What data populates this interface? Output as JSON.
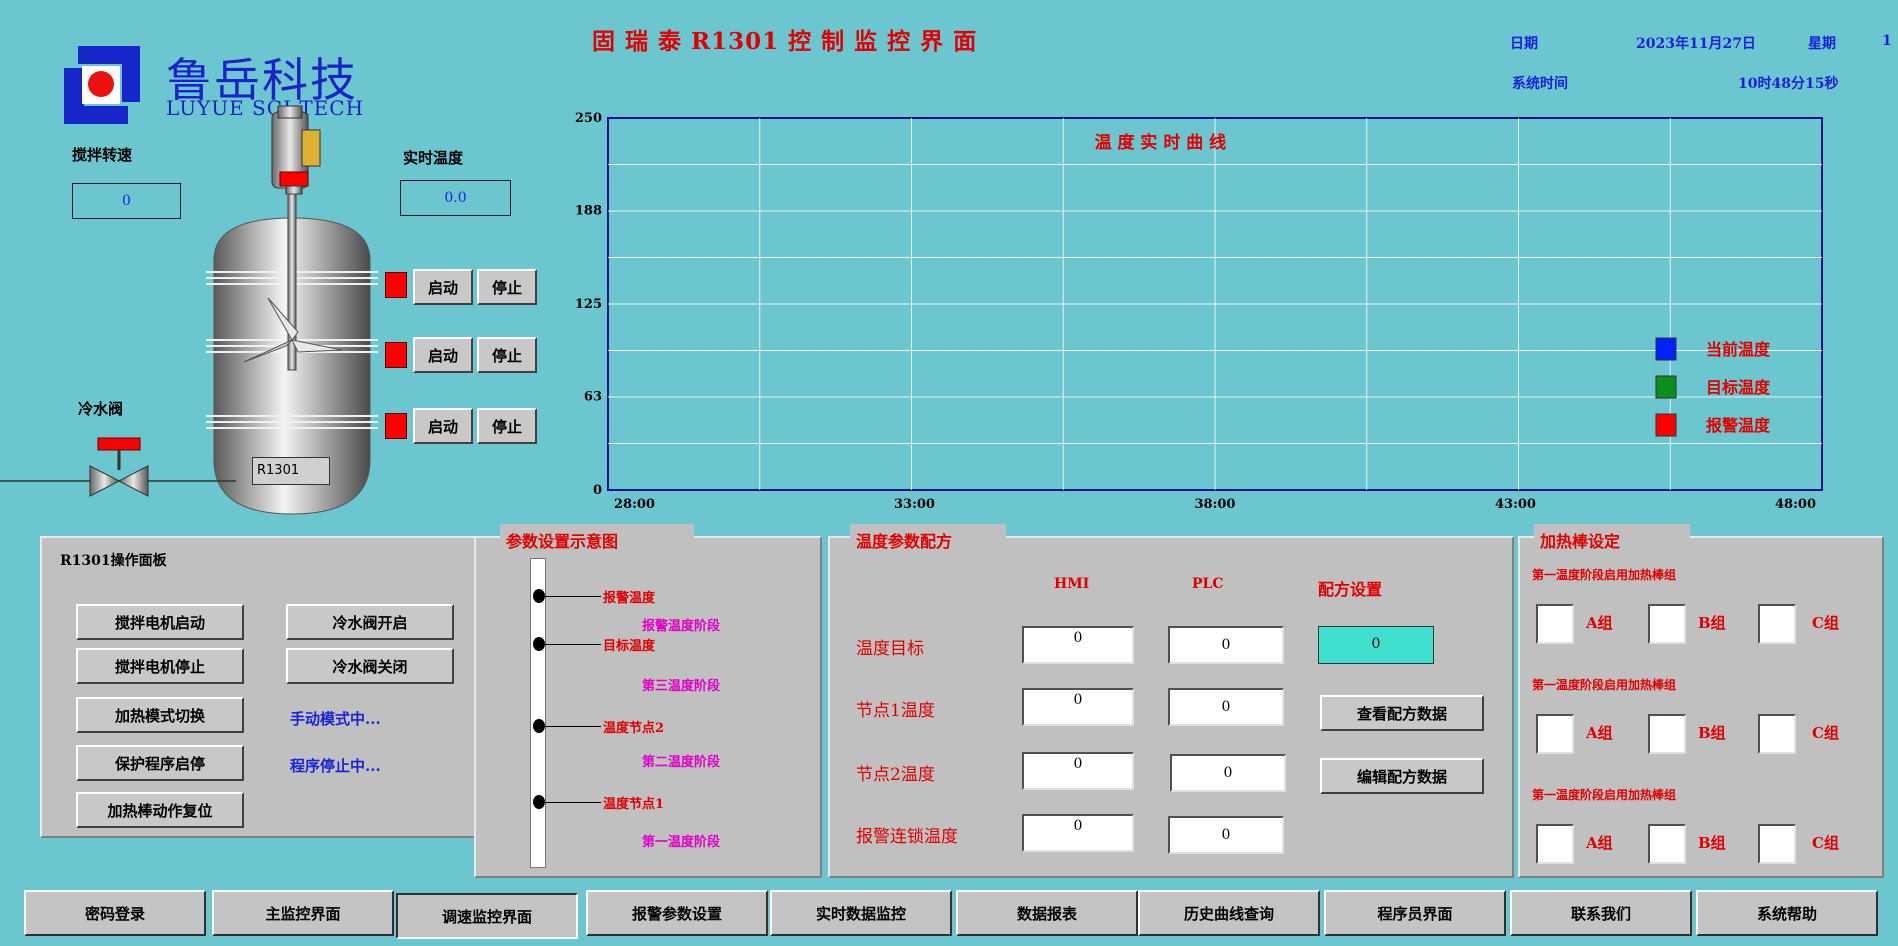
{
  "header": {
    "title": "固 瑞 泰 R1301 控 制 监 控 界 面",
    "date_label": "日期",
    "date_value": "2023年11月27日",
    "weekday_label": "星期",
    "weekday_value": "1",
    "time_label": "系统时间",
    "time_value": "10时48分15秒"
  },
  "logo": {
    "name_cn": "鲁岳科技",
    "name_en": "LUYUE SCI.TECH"
  },
  "reactor": {
    "stir_speed_label": "搅拌转速",
    "stir_speed_value": "0",
    "temp_label": "实时温度",
    "temp_value": "0.0",
    "cold_valve_label": "冷水阀",
    "vessel_tag": "R1301",
    "heaters": [
      {
        "start": "启动",
        "stop": "停止"
      },
      {
        "start": "启动",
        "stop": "停止"
      },
      {
        "start": "启动",
        "stop": "停止"
      }
    ],
    "colors": {
      "indicator": "#ff0000"
    }
  },
  "chart_data": {
    "type": "line",
    "title": "温 度 实 时 曲 线",
    "x_ticks": [
      "28:00",
      "33:00",
      "38:00",
      "43:00",
      "48:00"
    ],
    "y_ticks": [
      "250",
      "188",
      "125",
      "63",
      "0"
    ],
    "ylim": [
      0,
      250
    ],
    "grid": true,
    "legend_position": "right",
    "series": [
      {
        "name": "当前温度",
        "color": "#0022ff",
        "values": []
      },
      {
        "name": "目标温度",
        "color": "#0a8f1a",
        "values": []
      },
      {
        "name": "报警温度",
        "color": "#ff0000",
        "values": []
      }
    ]
  },
  "op_panel": {
    "title": "R1301操作面板",
    "buttons": [
      "搅拌电机启动",
      "搅拌电机停止",
      "加热模式切换",
      "保护程序启停",
      "加热棒动作复位",
      "冷水阀开启",
      "冷水阀关闭"
    ],
    "mode_status": "手动模式中...",
    "program_status": "程序停止中..."
  },
  "param_diagram": {
    "title": "参数设置示意图",
    "points": [
      "报警温度",
      "目标温度",
      "温度节点2",
      "温度节点1"
    ],
    "stages": [
      "报警温度阶段",
      "第三温度阶段",
      "第二温度阶段",
      "第一温度阶段"
    ]
  },
  "recipe": {
    "title": "温度参数配方",
    "col_hmi": "HMI",
    "col_plc": "PLC",
    "col_recipe": "配方设置",
    "rows": [
      {
        "label": "温度目标",
        "hmi": "0",
        "plc": "0"
      },
      {
        "label": "节点1温度",
        "hmi": "0",
        "plc": "0"
      },
      {
        "label": "节点2温度",
        "hmi": "0",
        "plc": "0"
      },
      {
        "label": "报警连锁温度",
        "hmi": "0",
        "plc": "0"
      }
    ],
    "recipe_value": "0",
    "view_button": "查看配方数据",
    "edit_button": "编辑配方数据"
  },
  "heater_set": {
    "title": "加热棒设定",
    "groups": [
      {
        "heading": "第一温度阶段启用加热棒组",
        "a": "A组",
        "b": "B组",
        "c": "C组"
      },
      {
        "heading": "第一温度阶段启用加热棒组",
        "a": "A组",
        "b": "B组",
        "c": "C组"
      },
      {
        "heading": "第一温度阶段启用加热棒组",
        "a": "A组",
        "b": "B组",
        "c": "C组"
      }
    ]
  },
  "nav": [
    "密码登录",
    "主监控界面",
    "调速监控界面",
    "报警参数设置",
    "实时数据监控",
    "数据报表",
    "历史曲线查询",
    "程序员界面",
    "联系我们",
    "系统帮助"
  ],
  "colors": {
    "background": "#6cc6cf",
    "panel": "#c0c0c0",
    "accent_red": "#e00000",
    "accent_blue": "#1a22d8"
  }
}
